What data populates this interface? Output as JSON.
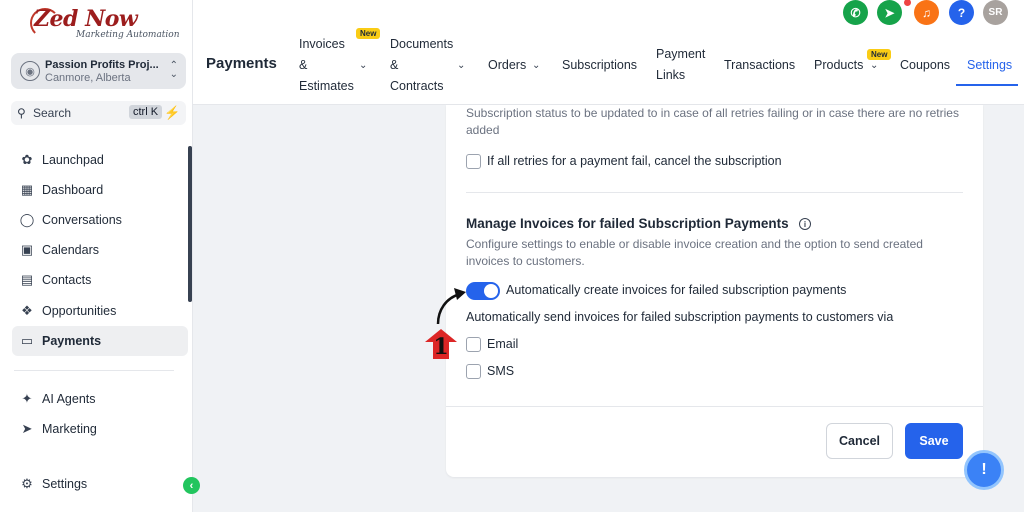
{
  "brand": {
    "logo_text": "Zed Now",
    "logo_sub": "Marketing Automation"
  },
  "account": {
    "name": "Passion Profits Proj...",
    "location": "Canmore, Alberta"
  },
  "search": {
    "label": "Search",
    "shortcut": "ctrl K"
  },
  "sidebar": {
    "items": [
      {
        "label": "Launchpad",
        "icon": "rocket-icon"
      },
      {
        "label": "Dashboard",
        "icon": "grid-icon"
      },
      {
        "label": "Conversations",
        "icon": "chat-icon"
      },
      {
        "label": "Calendars",
        "icon": "calendar-icon"
      },
      {
        "label": "Contacts",
        "icon": "contacts-icon"
      },
      {
        "label": "Opportunities",
        "icon": "funnel-icon"
      },
      {
        "label": "Payments",
        "icon": "receipt-icon",
        "active": true
      },
      {
        "label": "AI Agents",
        "icon": "sparkle-icon"
      },
      {
        "label": "Marketing",
        "icon": "send-icon"
      },
      {
        "label": "Settings",
        "icon": "gear-icon"
      }
    ]
  },
  "header": {
    "title": "Payments",
    "tabs": [
      {
        "label": "Invoices",
        "line2": "&",
        "line3": "Estimates",
        "badge": "New"
      },
      {
        "label": "Documents",
        "line2": "&",
        "line3": "Contracts"
      },
      {
        "label": "Orders"
      },
      {
        "label": "Subscriptions"
      },
      {
        "label": "Payment",
        "line2": "Links"
      },
      {
        "label": "Transactions"
      },
      {
        "label": "Products",
        "badge": "New"
      },
      {
        "label": "Coupons"
      },
      {
        "label": "Settings",
        "active": true
      }
    ],
    "user_initials": "SR",
    "help_label": "?"
  },
  "settings": {
    "retry_status_text": "Subscription status to be updated to in case of all retries failing or in case there are no retries added",
    "cancel_checkbox_label": "If all retries for a payment fail, cancel the subscription",
    "invoices_section_title": "Manage Invoices for failed Subscription Payments",
    "invoices_section_desc": "Configure settings to enable or disable invoice creation and the option to send created invoices to customers.",
    "auto_create_label": "Automatically create invoices for failed subscription payments",
    "auto_create_enabled": true,
    "auto_send_label": "Automatically send invoices for failed subscription payments to customers via",
    "email_label": "Email",
    "sms_label": "SMS"
  },
  "actions": {
    "cancel_label": "Cancel",
    "save_label": "Save"
  },
  "annotation": {
    "step_number": "1"
  },
  "colors": {
    "accent": "#2563eb",
    "success": "#22c55e",
    "brand": "#9c1d1d",
    "warning": "#f97316"
  }
}
